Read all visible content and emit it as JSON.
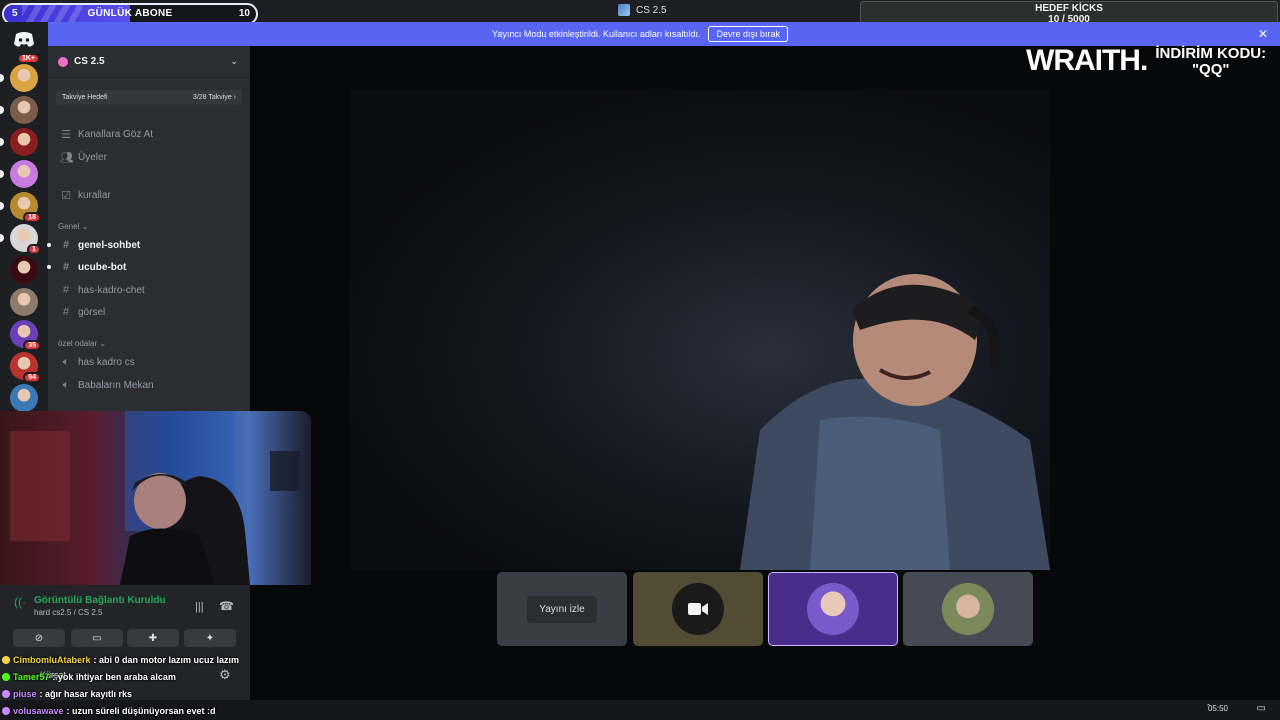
{
  "top_bar": {
    "sub_goal": {
      "current": "5",
      "label": "GÜNLÜK ABONE",
      "target": "10",
      "progress": 0.5
    },
    "window_title": "CS 2.5",
    "kicks_goal": {
      "title": "HEDEF KİCKS",
      "value": "10 / 5000"
    }
  },
  "banner": {
    "text": "Yayıncı Modu etkinleştirildi. Kullanıcı adları kısaltıldı.",
    "button": "Devre dışı bırak",
    "close_icon": "close-icon"
  },
  "rail": {
    "home_badge": "1K+",
    "servers": [
      {
        "badge": "",
        "color": "#d9a441"
      },
      {
        "badge": "",
        "color": "#7c5c4a"
      },
      {
        "badge": "",
        "color": "#8a1e1e"
      },
      {
        "badge": "",
        "color": "#c77ae0"
      },
      {
        "badge": "18",
        "color": "#b88a2e"
      },
      {
        "badge": "1",
        "color": "#d8d8d8"
      },
      {
        "badge": "",
        "color": "#3a0a12"
      },
      {
        "badge": "",
        "color": "#8c7b6b"
      },
      {
        "badge": "35",
        "color": "#6a3fb8"
      },
      {
        "badge": "94",
        "color": "#b8322e"
      },
      {
        "badge": "",
        "color": "#3a7ab8"
      }
    ]
  },
  "sidebar": {
    "server_name": "CS 2.5",
    "boost_goal": {
      "label": "Takviye Hedefi",
      "progress": "3/28 Takviye"
    },
    "top_items": [
      {
        "icon": "browse-channels-icon",
        "label": "Kanallara Göz At"
      },
      {
        "icon": "members-icon",
        "label": "Üyeler"
      }
    ],
    "rules_channel": "kurallar",
    "category_general": "Genel",
    "general_channels": [
      {
        "label": "genel-sohbet",
        "unread": true
      },
      {
        "label": "ucube-bot",
        "unread": true
      },
      {
        "label": "has-kadro-chet",
        "unread": false
      },
      {
        "label": "görsel",
        "unread": false
      }
    ],
    "category_private": "özel odalar",
    "voice_channels": [
      "has kadro cs",
      "Babaların Mekan"
    ]
  },
  "overlay": {
    "sponsor": "WRAITH.",
    "discount_label": "İNDİRİM KODU:",
    "discount_code": "\"QQ\""
  },
  "stage": {
    "tiles": [
      {
        "type": "stream",
        "label": "Yayını izle"
      },
      {
        "type": "camera",
        "icon": "video-camera-icon"
      },
      {
        "type": "user",
        "active": true
      },
      {
        "type": "user",
        "active": false
      }
    ]
  },
  "voice_panel": {
    "status": "Görüntülü Bağlantı Kuruldu",
    "channel": "hard cs2.5 / CS 2.5",
    "buttons": [
      "camera-off-icon",
      "screen-share-icon",
      "activities-icon",
      "soundboard-icon"
    ]
  },
  "user_panel": {
    "name": "Kürşat"
  },
  "chat": [
    {
      "user": "CimbomluAtaberk",
      "msg": " : abi 0 dan motor lazım ucuz lazım",
      "color": "#f5d742"
    },
    {
      "user": "Tamer57",
      "msg": " : yok ihtiyar ben araba alcam",
      "color": "#53fc18"
    },
    {
      "user": "piuse",
      "msg": " : ağır hasar kayıtlı rks",
      "color": "#c98bff"
    },
    {
      "user": "volusawave",
      "msg": " : uzun süreli düşünüyorsan evet :d",
      "color": "#c98bff"
    }
  ],
  "taskbar": {
    "clock": "05:50"
  }
}
